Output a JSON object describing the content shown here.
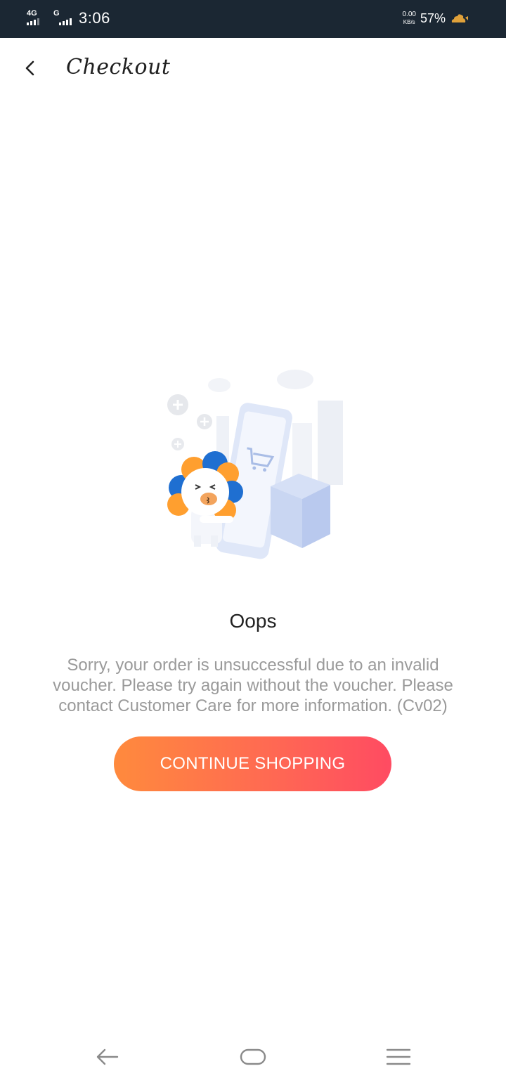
{
  "status_bar": {
    "network1": "4G",
    "network2": "G",
    "time": "3:06",
    "speed_value": "0.00",
    "speed_unit": "KB/s",
    "battery": "57%",
    "icons": [
      "signal-icon",
      "battery-icon"
    ]
  },
  "header": {
    "title": "Checkout",
    "back_icon": "chevron-left-icon"
  },
  "main": {
    "illustration": "mascot-phone-cart-illustration",
    "title": "Oops",
    "message": "Sorry, your order is unsuccessful due to an invalid voucher. Please try again without the voucher. Please contact Customer Care for more information. (Cv02)",
    "button_label": "CONTINUE SHOPPING",
    "button_colors": [
      "#ff8a3d",
      "#ff4b62"
    ]
  },
  "nav_bar": {
    "icons": [
      "back-arrow-icon",
      "home-icon",
      "menu-icon"
    ]
  }
}
